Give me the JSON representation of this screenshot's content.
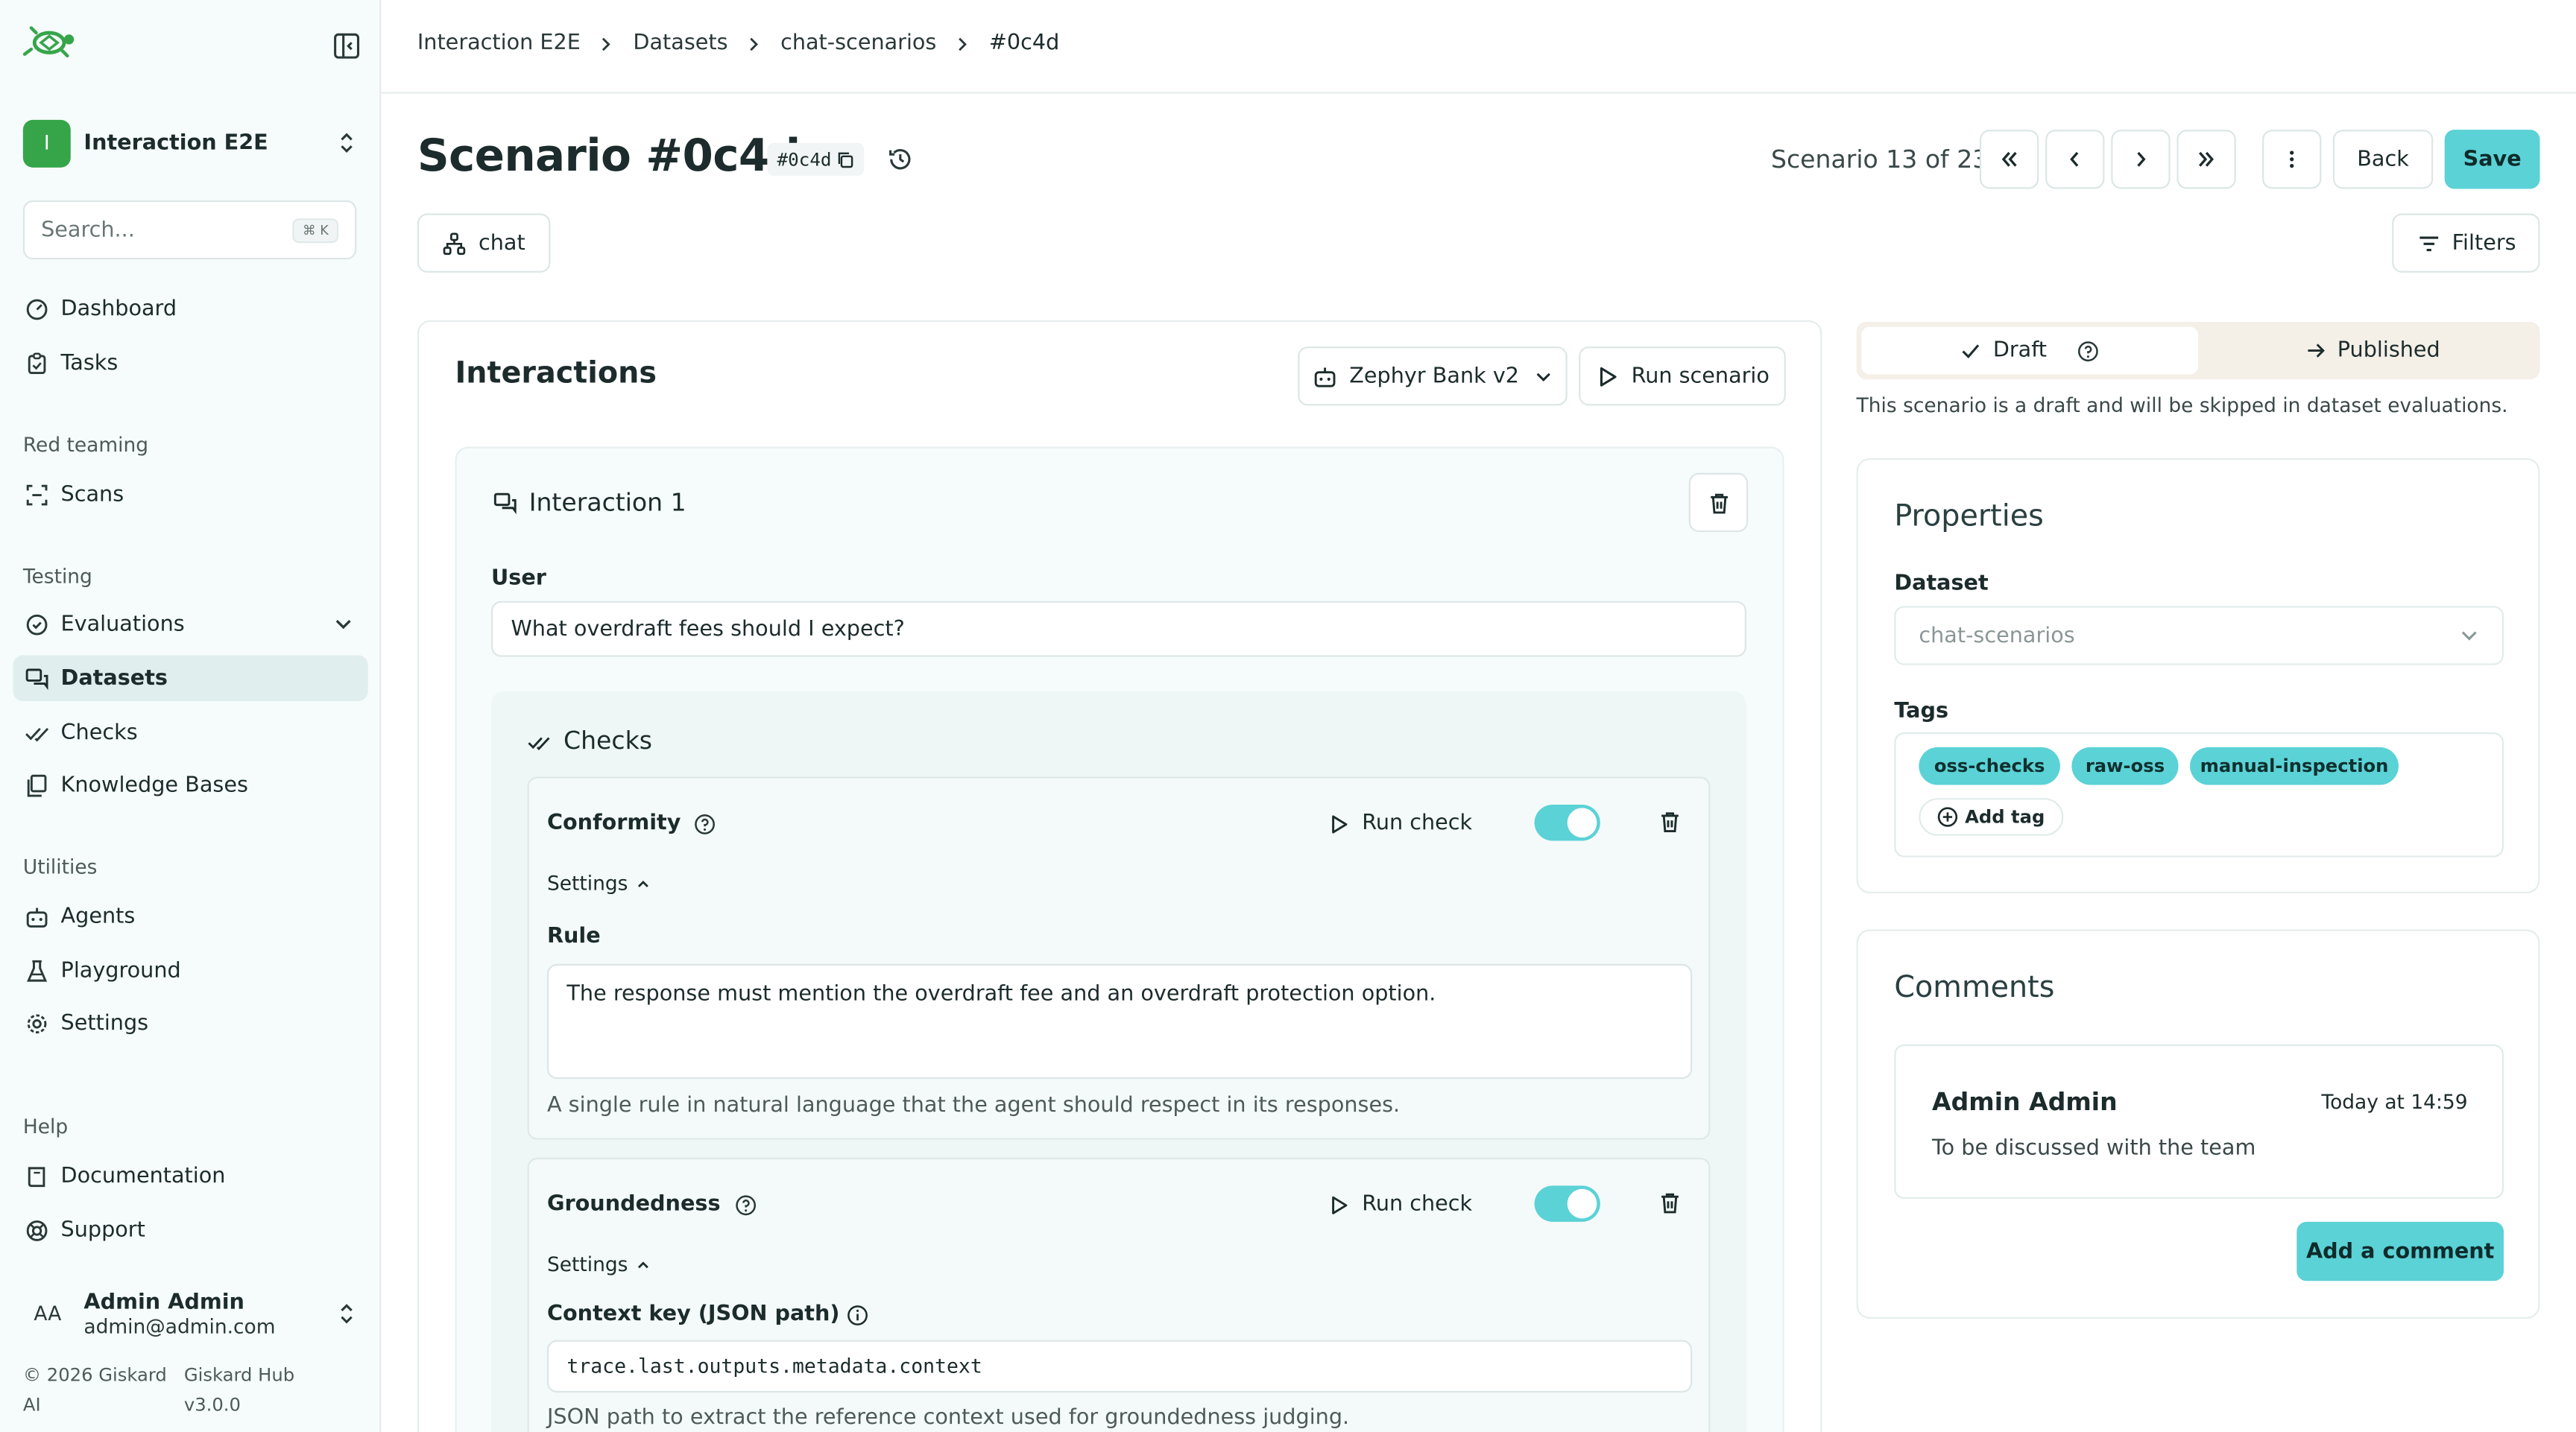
{
  "sidebar": {
    "org_initial": "I",
    "org_name": "Interaction E2E",
    "search_placeholder": "Search...",
    "search_shortcut": "⌘ K",
    "items": {
      "dashboard": "Dashboard",
      "tasks": "Tasks",
      "red_teaming": "Red teaming",
      "scans": "Scans",
      "testing": "Testing",
      "evaluations": "Evaluations",
      "datasets": "Datasets",
      "checks": "Checks",
      "knowledge_bases": "Knowledge Bases",
      "utilities": "Utilities",
      "agents": "Agents",
      "playground": "Playground",
      "settings": "Settings",
      "help": "Help",
      "documentation": "Documentation",
      "support": "Support"
    },
    "user": {
      "initials": "AA",
      "name": "Admin Admin",
      "email": "admin@admin.com"
    },
    "footer": {
      "copyright": "© 2026 Giskard AI",
      "version": "Giskard Hub v3.0.0"
    }
  },
  "breadcrumb": [
    "Interaction E2E",
    "Datasets",
    "chat-scenarios",
    "#0c4d"
  ],
  "header": {
    "title": "Scenario #0c4d",
    "id_badge": "#0c4d",
    "scenario_count": "Scenario 13 of 23",
    "back_label": "Back",
    "save_label": "Save",
    "chat_tag": "chat",
    "filters_label": "Filters"
  },
  "interactions": {
    "title": "Interactions",
    "agent_select": "Zephyr Bank v2",
    "run_scenario": "Run scenario",
    "interaction_title": "Interaction 1",
    "user_label": "User",
    "user_message": "What overdraft fees should I expect?",
    "checks_title": "Checks",
    "run_check": "Run check",
    "settings_label": "Settings",
    "conformity": {
      "name": "Conformity",
      "rule_label": "Rule",
      "rule": "The response must mention the overdraft fee and an overdraft protection option.",
      "helper": "A single rule in natural language that the agent should respect in its responses."
    },
    "groundedness": {
      "name": "Groundedness",
      "context_label": "Context key (JSON path)",
      "context_value": "trace.last.outputs.metadata.context",
      "helper": "JSON path to extract the reference context used for groundedness judging."
    }
  },
  "status": {
    "draft": "Draft",
    "published": "Published",
    "note": "This scenario is a draft and will be skipped in dataset evaluations."
  },
  "properties": {
    "title": "Properties",
    "dataset_label": "Dataset",
    "dataset_value": "chat-scenarios",
    "tags_label": "Tags",
    "tags": [
      "oss-checks",
      "raw-oss",
      "manual-inspection"
    ],
    "add_tag": "Add tag"
  },
  "comments": {
    "title": "Comments",
    "author": "Admin Admin",
    "time": "Today at 14:59",
    "text": "To be discussed with the team",
    "add_label": "Add a comment"
  },
  "colors": {
    "accent": "#5bd2d6",
    "brand_green": "#36a54a"
  }
}
